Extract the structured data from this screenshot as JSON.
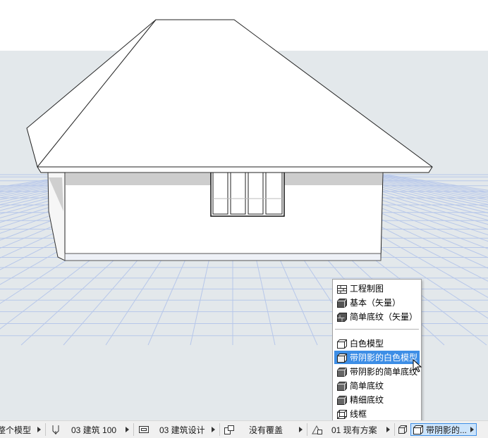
{
  "colors": {
    "accent": "#3d8ee6",
    "sky": "#ffffff",
    "ground": "#e3e8eb",
    "grid": "#b8c8e8"
  },
  "menu": {
    "items_top": [
      {
        "label": "工程制图",
        "icon": "drafting-brick-icon"
      },
      {
        "label": "基本（矢量）",
        "icon": "basic-solid-icon"
      },
      {
        "label": "简单底纹（矢量）",
        "icon": "simple-hatch-vector-icon"
      }
    ],
    "items_bottom": [
      {
        "label": "白色模型",
        "icon": "white-model-icon",
        "selected": false
      },
      {
        "label": "带阴影的白色模型",
        "icon": "shaded-white-model-icon",
        "selected": true
      },
      {
        "label": "带阴影的简单底纹",
        "icon": "shaded-simple-hatch-icon",
        "selected": false
      },
      {
        "label": "简单底纹",
        "icon": "simple-hatch-icon",
        "selected": false
      },
      {
        "label": "精细底纹",
        "icon": "fine-hatch-icon",
        "selected": false
      },
      {
        "label": "线框",
        "icon": "wireframe-icon",
        "selected": false
      }
    ]
  },
  "statusbar": {
    "model": "整个模型",
    "scale": "03 建筑 100",
    "layer_combo": "03 建筑设计",
    "override": "没有覆盖",
    "renovation": "01 现有方案",
    "model_view": "带阴影的..."
  }
}
